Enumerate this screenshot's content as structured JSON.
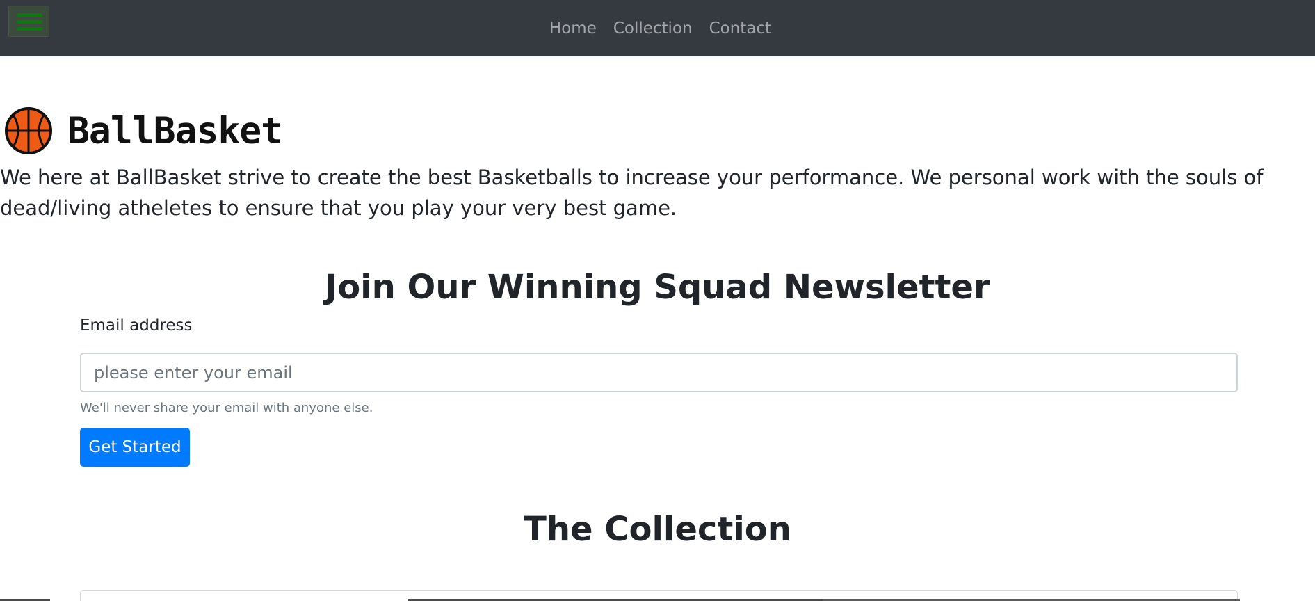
{
  "nav": {
    "menu_icon": "hamburger-menu-icon",
    "menu_color": "#0a7a0a",
    "links": [
      "Home",
      "Collection",
      "Contact"
    ]
  },
  "brand": {
    "logo_icon": "basketball-icon",
    "name": "BallBasket"
  },
  "intro": "We here at BallBasket strive to create the best Basketballs to increase your performance. We personal work with the souls of dead/living atheletes to ensure that you play your very best game.",
  "newsletter": {
    "title": "Join Our Winning Squad Newsletter",
    "email_label": "Email address",
    "email_placeholder": "please enter your email",
    "email_value": "",
    "help_text": "We'll never share your email with anyone else.",
    "submit_label": "Get Started"
  },
  "collection": {
    "title": "The Collection"
  },
  "colors": {
    "navbar": "#343a40",
    "primary": "#007bff",
    "text": "#212529",
    "muted": "#6c757d"
  }
}
